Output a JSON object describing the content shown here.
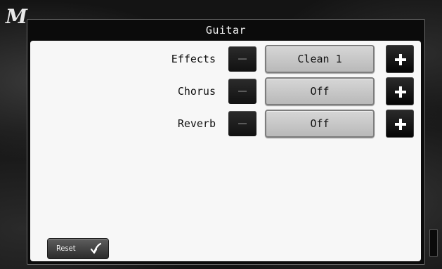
{
  "window": {
    "title": "Guitar"
  },
  "settings": [
    {
      "label": "Effects",
      "value": "Clean 1"
    },
    {
      "label": "Chorus",
      "value": "Off"
    },
    {
      "label": "Reverb",
      "value": "Off"
    }
  ],
  "controls": {
    "decrement_icon": "minus-icon",
    "increment_icon": "plus-icon"
  },
  "reset": {
    "label": "Reset",
    "icon": "return-arrow-icon"
  },
  "background": {
    "logo_glyph": "M"
  },
  "colors": {
    "panel_background": "#f7f7f7",
    "window_background": "#0b0b0b",
    "value_box": "#c8c8c8",
    "button_dark": "#111111"
  }
}
